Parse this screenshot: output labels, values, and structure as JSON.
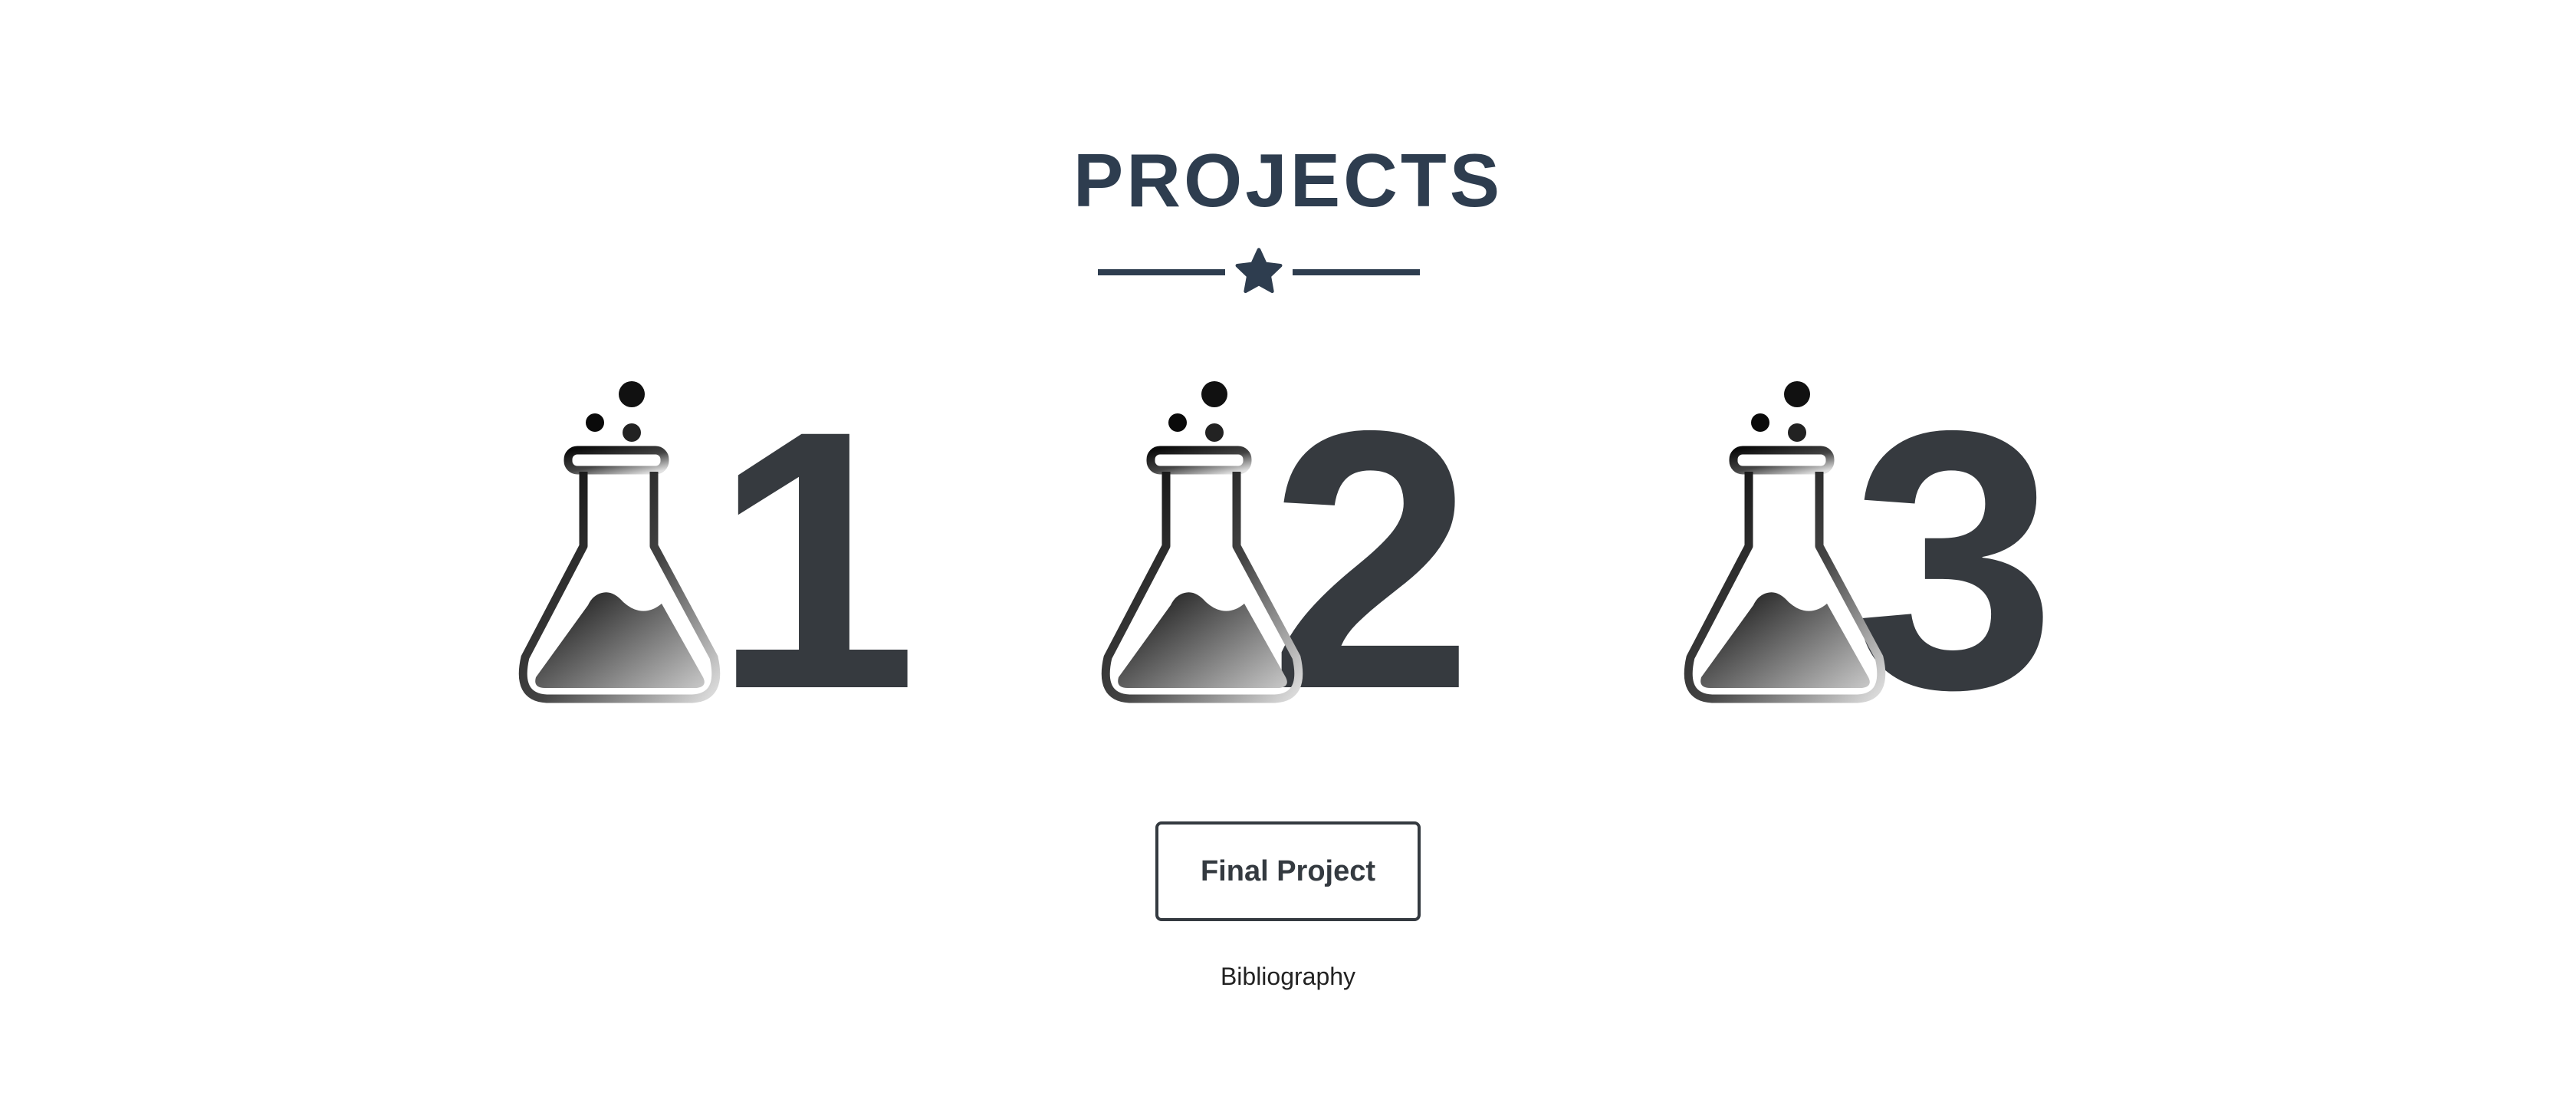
{
  "header": {
    "title": "PROJECTS",
    "divider_icon": "star-icon"
  },
  "projects": [
    {
      "number": "1",
      "icon": "flask-icon"
    },
    {
      "number": "2",
      "icon": "flask-icon"
    },
    {
      "number": "3",
      "icon": "flask-icon"
    }
  ],
  "final_button": {
    "label": "Final Project"
  },
  "bibliography_link": {
    "label": "Bibliography"
  },
  "colors": {
    "heading": "#2e3d4f",
    "numbers": "#363a3f",
    "button": "#343a40"
  }
}
